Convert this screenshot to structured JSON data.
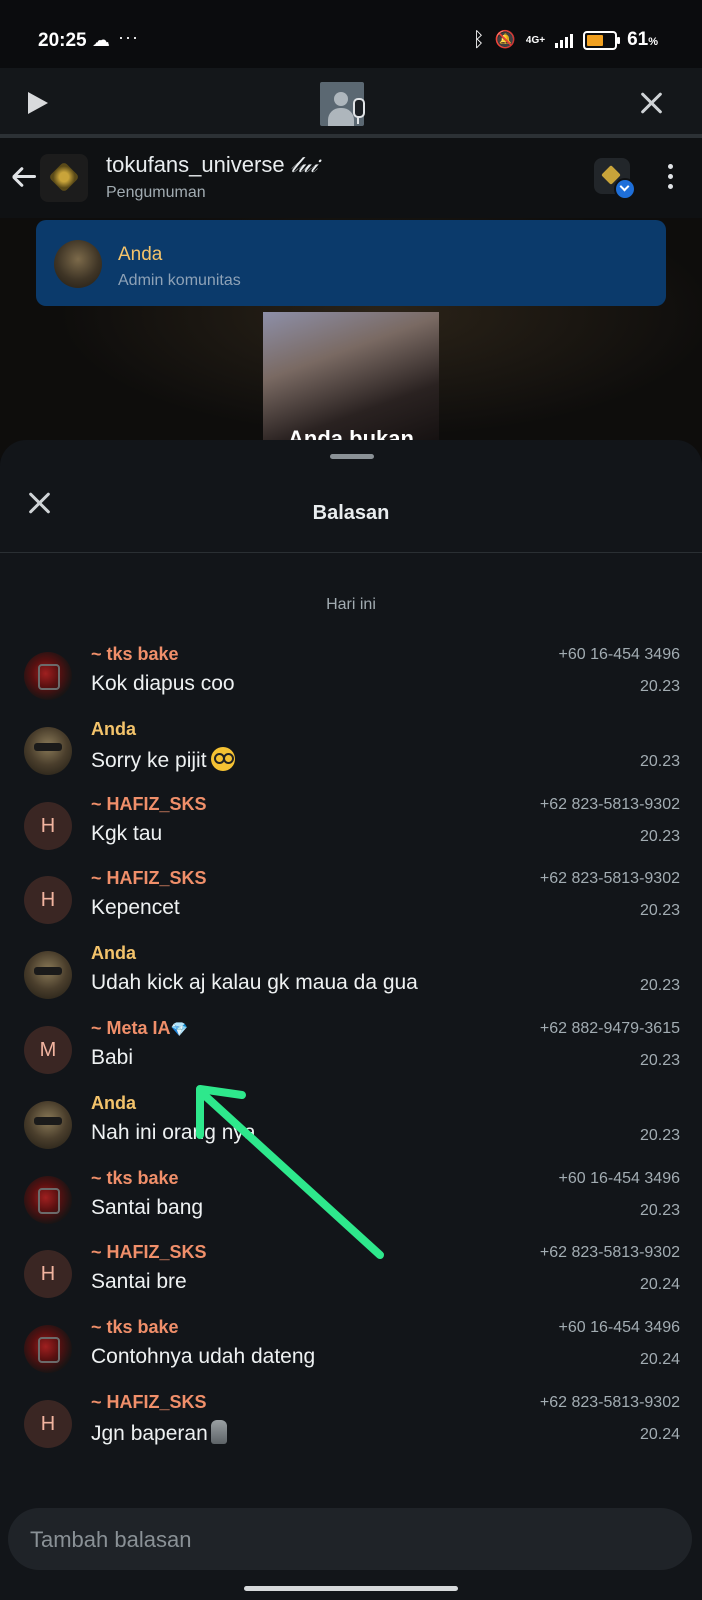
{
  "status_bar": {
    "time": "20:25",
    "more": "···",
    "network": "4G+",
    "battery": "61",
    "battery_unit": "%",
    "battery_level": 0.61
  },
  "chat_header": {
    "title": "tokufans_universe",
    "title_suffix": "𝓁𝓊𝒾",
    "subtitle": "Pengumuman"
  },
  "quoted_message": {
    "sender": "Anda",
    "role": "Admin komunitas",
    "media_caption": "Anda bukan"
  },
  "sheet": {
    "title": "Balasan",
    "day_label": "Hari ini"
  },
  "messages": [
    {
      "sender": "~ tks bake",
      "phone": "+60 16-454 3496",
      "text": "Kok diapus coo",
      "time": "20.23"
    },
    {
      "sender": "Anda",
      "phone": "",
      "text": "Sorry ke pijit",
      "time": "20.23"
    },
    {
      "sender": "~ HAFIZ_SKS",
      "phone": "+62 823-5813-9302",
      "text": "Kgk tau",
      "time": "20.23",
      "initial": "H"
    },
    {
      "sender": "~ HAFIZ_SKS",
      "phone": "+62 823-5813-9302",
      "text": "Kepencet",
      "time": "20.23",
      "initial": "H"
    },
    {
      "sender": "Anda",
      "phone": "",
      "text": "Udah kick aj kalau gk maua da gua",
      "time": "20.23"
    },
    {
      "sender": "~ Meta IA",
      "sender_suffix": "💎",
      "phone": "+62 882-9479-3615",
      "text": "Babi",
      "time": "20.23",
      "initial": "M"
    },
    {
      "sender": "Anda",
      "phone": "",
      "text": "Nah ini orang nya",
      "time": "20.23"
    },
    {
      "sender": "~ tks bake",
      "phone": "+60 16-454 3496",
      "text": "Santai bang",
      "time": "20.23"
    },
    {
      "sender": "~ HAFIZ_SKS",
      "phone": "+62 823-5813-9302",
      "text": "Santai bre",
      "time": "20.24",
      "initial": "H"
    },
    {
      "sender": "~ tks bake",
      "phone": "+60 16-454 3496",
      "text": "Contohnya udah dateng",
      "time": "20.24"
    },
    {
      "sender": "~ HAFIZ_SKS",
      "phone": "+62 823-5813-9302",
      "text": "Jgn baperan",
      "time": "20.24",
      "initial": "H"
    }
  ],
  "reply_input": {
    "placeholder": "Tambah balasan",
    "value": ""
  },
  "colors": {
    "own_sender": "#f3c36b",
    "other_sender": "#f08f6a",
    "quote_bg": "#0b3a6b",
    "annotation_arrow": "#2ee88c"
  },
  "icons": [
    "play-icon",
    "close-icon",
    "back-arrow-icon",
    "more-vert-icon",
    "bluetooth-icon",
    "mute-icon",
    "wifi-icon",
    "signal-icon",
    "battery-icon",
    "cloud-icon"
  ]
}
